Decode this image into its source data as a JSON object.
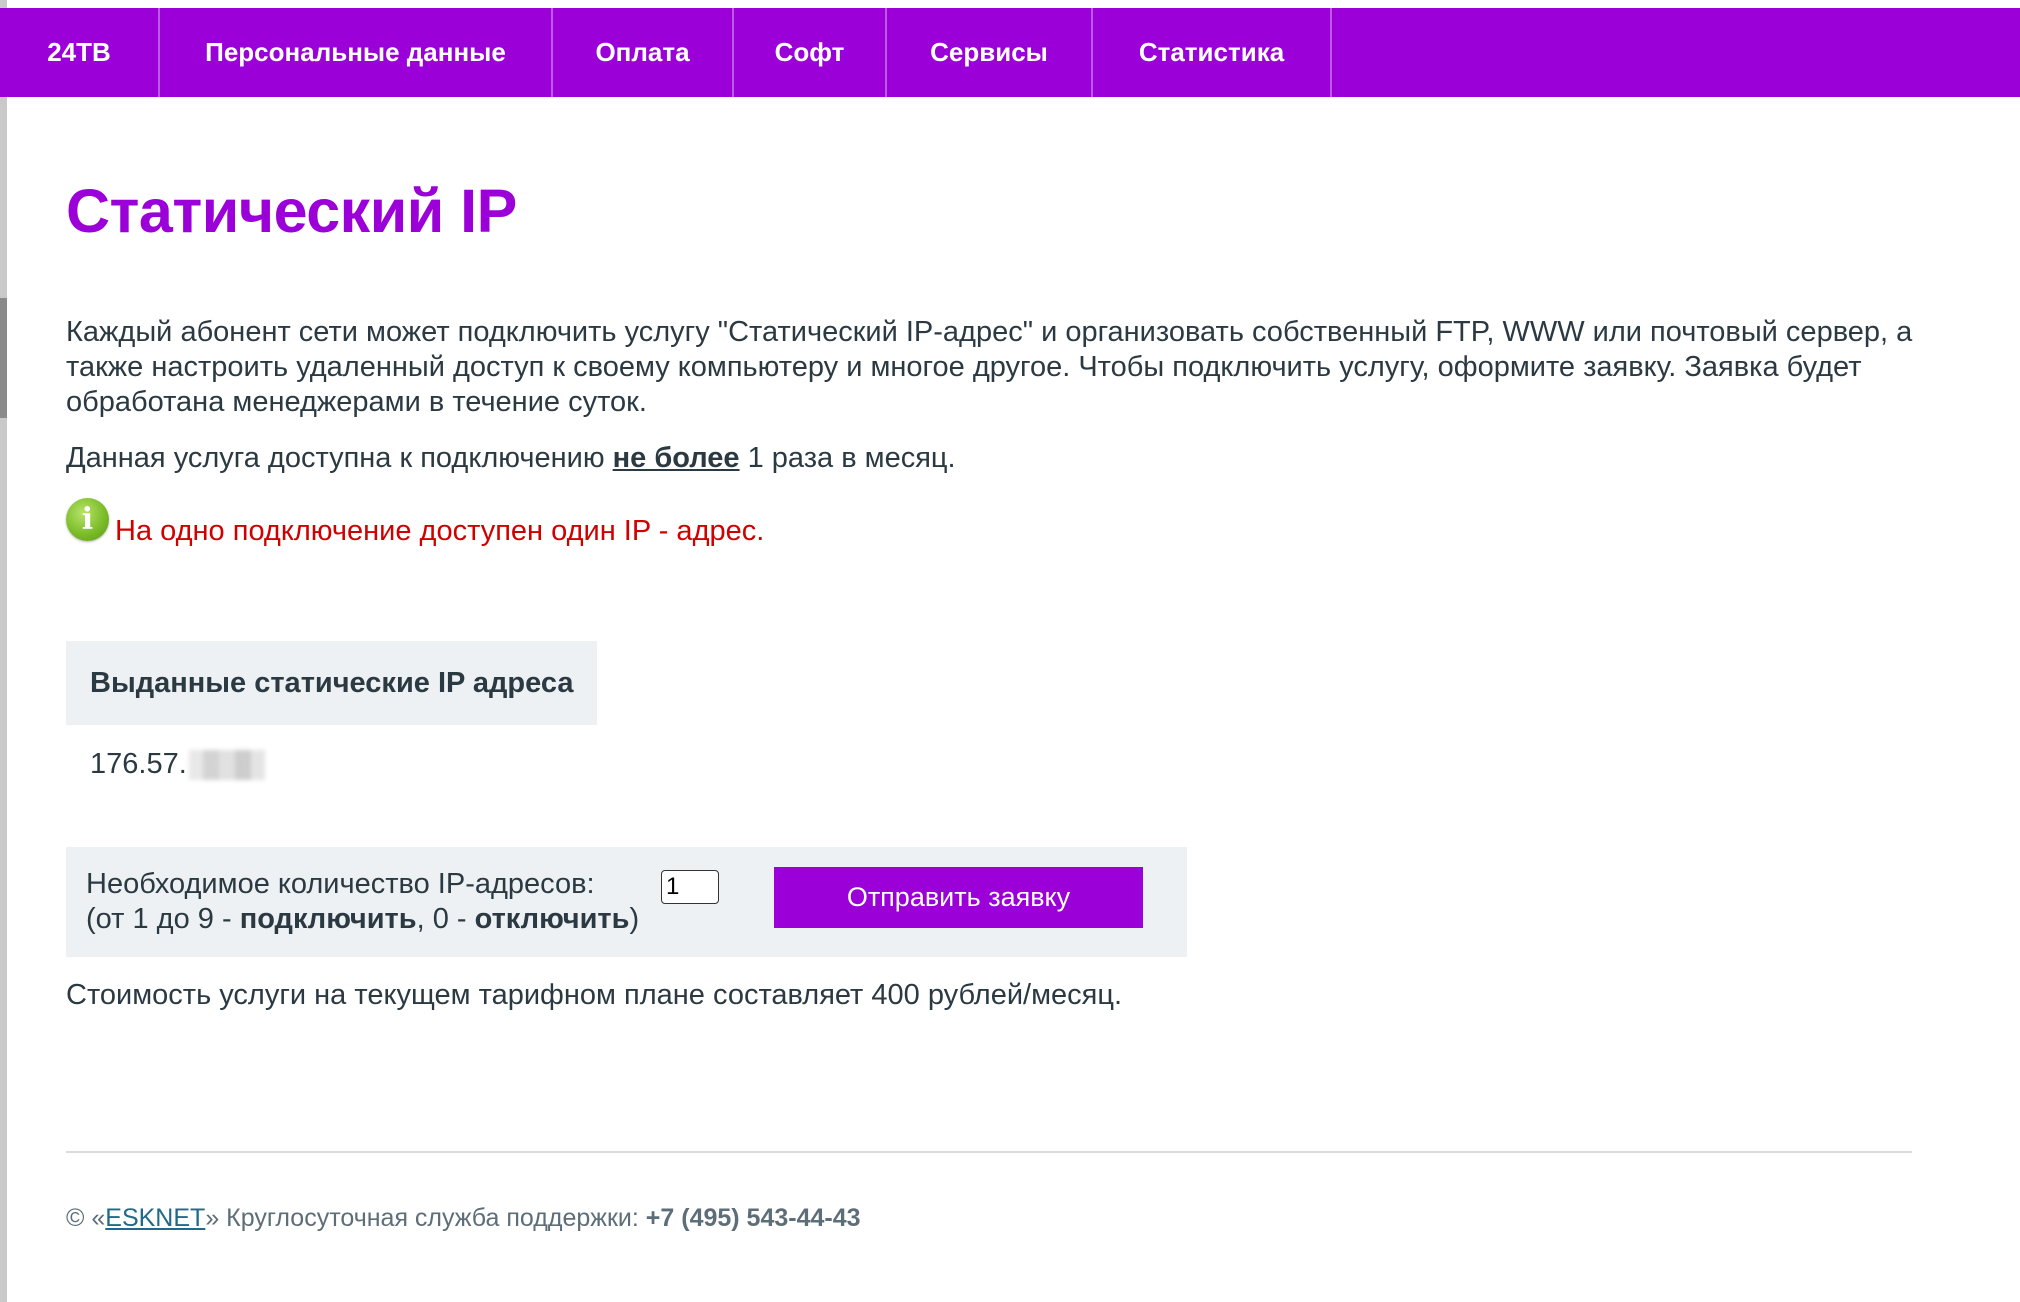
{
  "nav": {
    "items": [
      {
        "label": "24ТВ"
      },
      {
        "label": "Персональные данные"
      },
      {
        "label": "Оплата"
      },
      {
        "label": "Софт"
      },
      {
        "label": "Сервисы"
      },
      {
        "label": "Статистика"
      }
    ]
  },
  "page": {
    "title": "Статический IP",
    "intro": "Каждый абонент сети может подключить услугу \"Статический IP-адрес\" и организовать собственный FTP, WWW или почтовый сервер, а также настроить удаленный доступ к своему компьютеру и многое другое. Чтобы подключить услугу, оформите заявку. Заявка будет обработана менеджерами в течение суток.",
    "limit_prefix": "Данная услуга доступна к подключению ",
    "limit_emphasis": "не более",
    "limit_suffix": " 1 раза в месяц.",
    "notice_icon": "info-icon",
    "notice": "На одно подключение доступен один IP - адрес.",
    "notice_color": "#d00000"
  },
  "issued": {
    "header": "Выданные статические IP адреса",
    "ip_visible": "176.57."
  },
  "request": {
    "label_line1": "Необходимое количество IP-адресов:",
    "label_line2_prefix": "(от 1 до 9 - ",
    "label_connect": "подключить",
    "label_mid": ", 0 - ",
    "label_disconnect": "отключить",
    "label_suffix": ")",
    "quantity_value": "1",
    "submit_label": "Отправить заявку"
  },
  "price_text": "Стоимость услуги на текущем тарифном плане составляет 400 рублей/месяц.",
  "footer": {
    "copyright_prefix": "© «",
    "company_link": "ESKNET",
    "support_text": "» Круглосуточная служба поддержки: ",
    "phone": "+7 (495) 543-44-43"
  },
  "colors": {
    "brand": "#9b00d9",
    "panel_bg": "#eef1f3",
    "text": "#2b3a42"
  }
}
